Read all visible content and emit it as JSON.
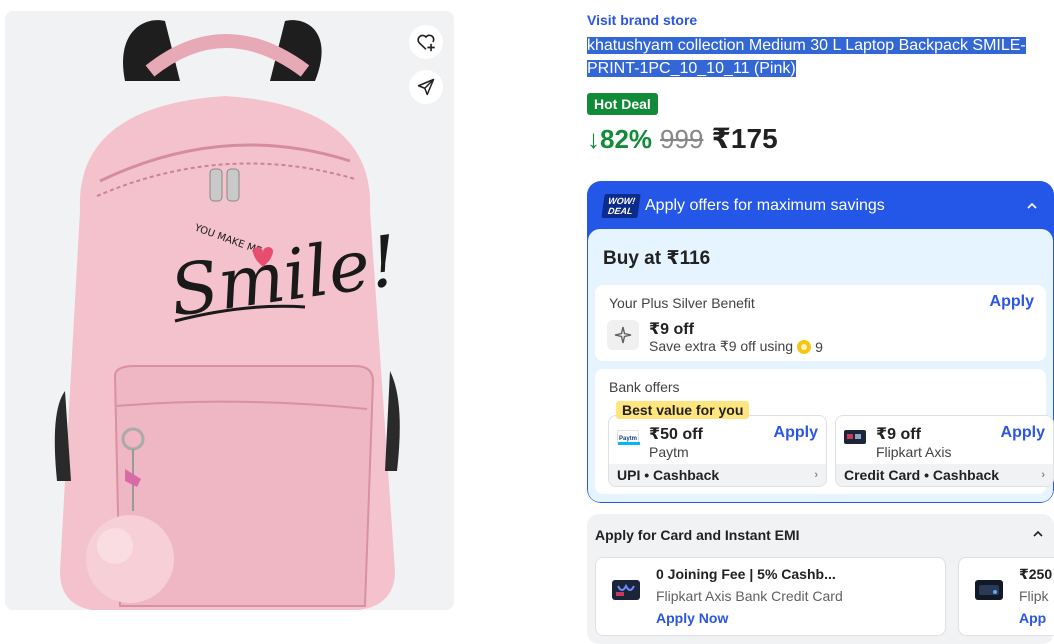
{
  "product_image": {
    "alt": "Pink backpack",
    "print_text": "Smile!",
    "print_small": "YOU MAKE ME",
    "wishlist_icon": "heart-plus-icon",
    "share_icon": "share-icon"
  },
  "brand": {
    "link_label": "Visit brand store"
  },
  "title": "khatushyam collection Medium 30 L Laptop Backpack SMILE-PRINT-1PC_10_10_11 (Pink)",
  "deal_badge": "Hot Deal",
  "pricing": {
    "discount": "↓82%",
    "mrp": "999",
    "price": "₹175"
  },
  "offers": {
    "badge_line1": "WOW!",
    "badge_line2": "DEAL",
    "header_label": "Apply offers for maximum savings",
    "buy_at": "Buy at ₹116",
    "plus": {
      "title": "Your Plus Silver Benefit",
      "apply": "Apply",
      "amount": "₹9 off",
      "desc": "Save extra ₹9 off using",
      "coins": "9"
    },
    "bank": {
      "title": "Bank offers",
      "best_badge": "Best value for you",
      "items": [
        {
          "amount": "₹50 off",
          "name": "Paytm",
          "apply": "Apply",
          "footer": "UPI • Cashback",
          "logo_text": "Paytm"
        },
        {
          "amount": "₹9 off",
          "name": "Flipkart Axis",
          "apply": "Apply",
          "footer": "Credit Card • Cashback",
          "logo_text": ""
        }
      ]
    }
  },
  "emi": {
    "title": "Apply for Card and Instant EMI",
    "cards": [
      {
        "heading": "0 Joining Fee | 5% Cashb...",
        "sub": "Flipkart Axis Bank Credit Card",
        "cta": "Apply Now"
      },
      {
        "heading": "₹250",
        "sub": "Flipk",
        "cta": "App"
      }
    ]
  },
  "colors": {
    "accent": "#2a55e5",
    "deal_green": "#128b38",
    "offer_blue": "#2456e8",
    "bag_pink": "#f4c2cd"
  }
}
